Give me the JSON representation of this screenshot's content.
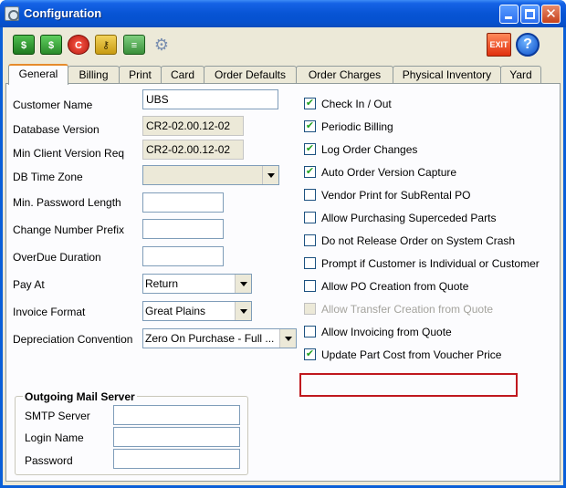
{
  "window": {
    "title": "Configuration"
  },
  "toolbar": {
    "icons": [
      "save-billing-icon",
      "invoice-icon",
      "clear-icon",
      "users-icon",
      "report-icon",
      "settings-icon"
    ],
    "exit_label": "EXIT",
    "help_label": "?"
  },
  "tabs": [
    {
      "label": "General",
      "active": true
    },
    {
      "label": "Billing"
    },
    {
      "label": "Print"
    },
    {
      "label": "Card"
    },
    {
      "label": "Order Defaults"
    },
    {
      "label": "Order  Charges"
    },
    {
      "label": "Physical Inventory"
    },
    {
      "label": "Yard"
    }
  ],
  "general": {
    "customer_name_label": "Customer Name",
    "customer_name": "UBS",
    "database_version_label": "Database Version",
    "database_version": "CR2-02.00.12-02",
    "min_client_label": "Min Client Version Req",
    "min_client_version": "CR2-02.00.12-02",
    "db_time_zone_label": "DB Time Zone",
    "db_time_zone": "",
    "min_password_label": "Min. Password Length",
    "min_password_length": "",
    "change_number_prefix_label": "Change Number Prefix",
    "change_number_prefix": "",
    "overdue_duration_label": "OverDue Duration",
    "overdue_duration": "",
    "pay_at_label": "Pay At",
    "pay_at": "Return",
    "invoice_format_label": "Invoice Format",
    "invoice_format": "Great Plains",
    "depreciation_label": "Depreciation Convention",
    "depreciation": "Zero On Purchase - Full ..."
  },
  "mail": {
    "title": "Outgoing Mail Server",
    "smtp_label": "SMTP Server",
    "smtp": "",
    "login_label": "Login Name",
    "login": "",
    "password_label": "Password",
    "password": ""
  },
  "checkboxes": [
    {
      "label": "Check In / Out",
      "checked": true,
      "enabled": true
    },
    {
      "label": "Periodic Billing",
      "checked": true,
      "enabled": true
    },
    {
      "label": "Log Order Changes",
      "checked": true,
      "enabled": true
    },
    {
      "label": "Auto Order Version Capture",
      "checked": true,
      "enabled": true
    },
    {
      "label": "Vendor Print for SubRental PO",
      "checked": false,
      "enabled": true
    },
    {
      "label": "Allow Purchasing Superceded Parts",
      "checked": false,
      "enabled": true
    },
    {
      "label": "Do not Release Order on System Crash",
      "checked": false,
      "enabled": true
    },
    {
      "label": "Prompt if Customer is Individual or Customer",
      "checked": false,
      "enabled": true
    },
    {
      "label": "Allow PO Creation from Quote",
      "checked": false,
      "enabled": true
    },
    {
      "label": "Allow Transfer Creation from Quote",
      "checked": false,
      "enabled": false
    },
    {
      "label": "Allow Invoicing from Quote",
      "checked": false,
      "enabled": true
    },
    {
      "label": "Update Part Cost from Voucher Price",
      "checked": true,
      "enabled": true
    }
  ],
  "check_glyph": "✔"
}
